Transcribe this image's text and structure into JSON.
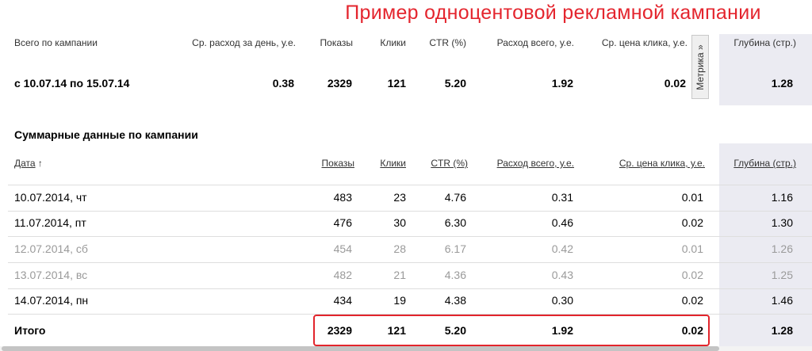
{
  "title": "Пример одноцентовой рекламной кампании",
  "metrika_label": "Метрика »",
  "overview": {
    "headers": [
      "Всего по кампании",
      "Ср. расход за день, у.е.",
      "Показы",
      "Клики",
      "CTR (%)",
      "Расход всего, у.е.",
      "Ср. цена клика, у.е.",
      "Глубина (стр.)"
    ],
    "row": [
      "с 10.07.14 по 15.07.14",
      "0.38",
      "2329",
      "121",
      "5.20",
      "1.92",
      "0.02",
      "1.28"
    ]
  },
  "summary": {
    "title": "Суммарные данные по кампании",
    "sort_indicator": "↑",
    "headers": [
      "Дата",
      "Показы",
      "Клики",
      "CTR (%)",
      "Расход всего, у.е.",
      "Ср. цена клика, у.е.",
      "Глубина (стр.)"
    ],
    "rows": [
      [
        "10.07.2014, чт",
        "483",
        "23",
        "4.76",
        "0.31",
        "0.01",
        "1.16"
      ],
      [
        "11.07.2014, пт",
        "476",
        "30",
        "6.30",
        "0.46",
        "0.02",
        "1.30"
      ],
      [
        "12.07.2014, сб",
        "454",
        "28",
        "6.17",
        "0.42",
        "0.01",
        "1.26"
      ],
      [
        "13.07.2014, вс",
        "482",
        "21",
        "4.36",
        "0.43",
        "0.02",
        "1.25"
      ],
      [
        "14.07.2014, пн",
        "434",
        "19",
        "4.38",
        "0.30",
        "0.02",
        "1.46"
      ]
    ],
    "weekend_rows": [
      2,
      3
    ],
    "total": [
      "Итого",
      "2329",
      "121",
      "5.20",
      "1.92",
      "0.02",
      "1.28"
    ]
  },
  "colors": {
    "title": "#e4252e",
    "highlight": "#e2252c",
    "weekend_text": "#9a9a9a",
    "depth_column_bg": "#ebebf2"
  }
}
